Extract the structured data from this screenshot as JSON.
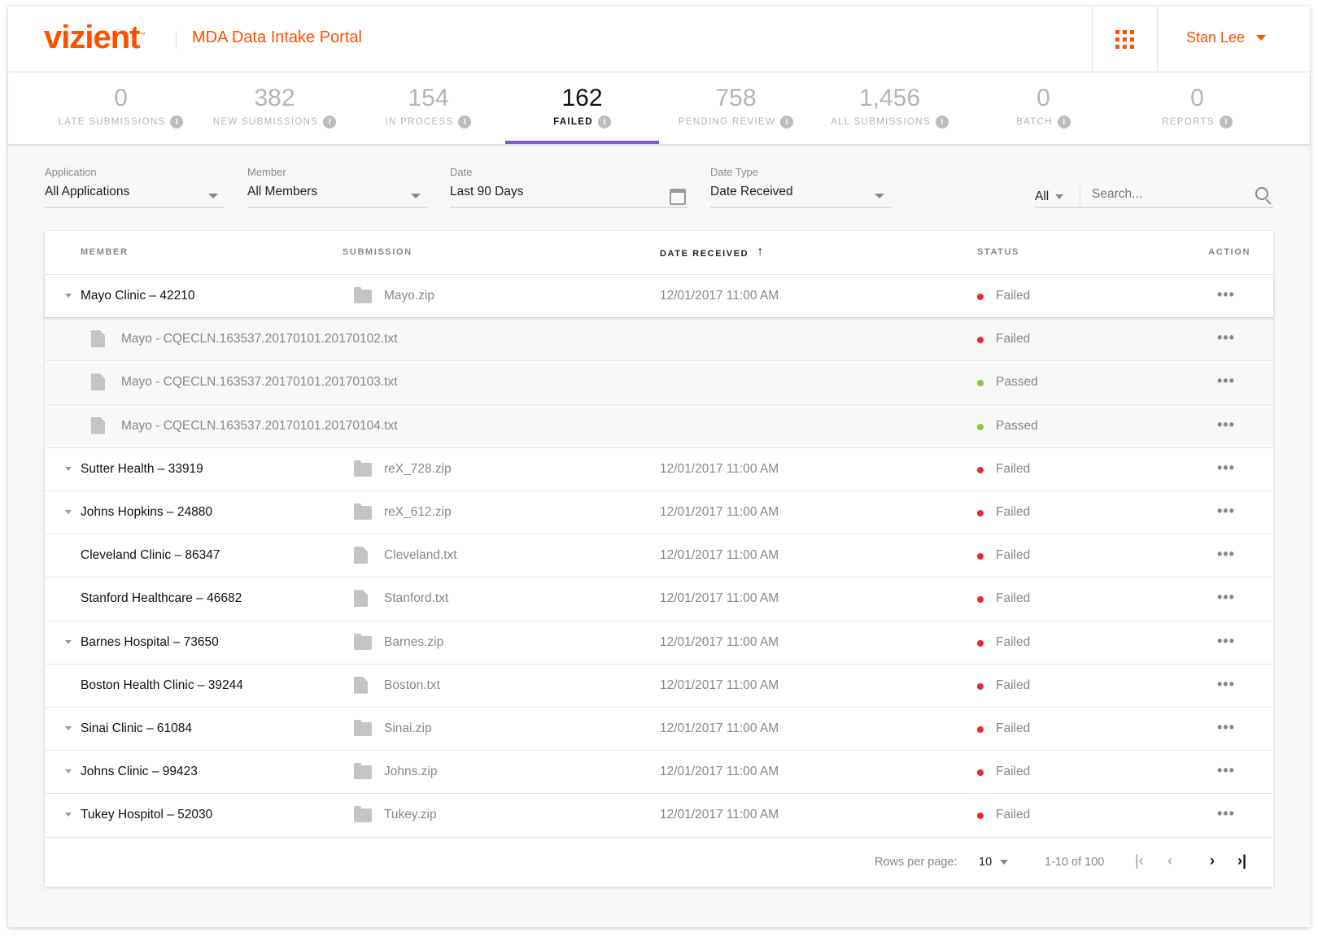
{
  "header": {
    "logo": "vizient",
    "app_title": "MDA Data Intake Portal",
    "user_name": "Stan Lee"
  },
  "tabs": [
    {
      "count": "0",
      "label": "LATE SUBMISSIONS",
      "active": false
    },
    {
      "count": "382",
      "label": "NEW SUBMISSIONS",
      "active": false
    },
    {
      "count": "154",
      "label": "IN PROCESS",
      "active": false
    },
    {
      "count": "162",
      "label": "FAILED",
      "active": true
    },
    {
      "count": "758",
      "label": "PENDING REVIEW",
      "active": false
    },
    {
      "count": "1,456",
      "label": "ALL SUBMISSIONS",
      "active": false
    },
    {
      "count": "0",
      "label": "BATCH",
      "active": false
    },
    {
      "count": "0",
      "label": "REPORTS",
      "active": false
    }
  ],
  "info_glyph": "i",
  "filters": {
    "application": {
      "label": "Application",
      "value": "All Applications"
    },
    "member": {
      "label": "Member",
      "value": "All Members"
    },
    "date": {
      "label": "Date",
      "value": "Last 90 Days"
    },
    "date_type": {
      "label": "Date Type",
      "value": "Date Received"
    },
    "scope": "All",
    "search_placeholder": "Search..."
  },
  "table": {
    "columns": {
      "member": "MEMBER",
      "submission": "SUBMISSION",
      "date": "DATE RECEIVED",
      "status": "STATUS",
      "action": "ACTION"
    },
    "sort_arrow": "↑",
    "rows": [
      {
        "kind": "parent",
        "expandable": true,
        "expanded": true,
        "member": "Mayo Clinic – 42210",
        "icon": "folder",
        "submission": "Mayo.zip",
        "date": "12/01/2017 11:00 AM",
        "status": "Failed"
      },
      {
        "kind": "child",
        "icon": "file",
        "submission": "Mayo - CQECLN.163537.20170101.20170102.txt",
        "date": "",
        "status": "Failed"
      },
      {
        "kind": "child",
        "icon": "file",
        "submission": "Mayo - CQECLN.163537.20170101.20170103.txt",
        "date": "",
        "status": "Passed"
      },
      {
        "kind": "child",
        "icon": "file",
        "submission": "Mayo - CQECLN.163537.20170101.20170104.txt",
        "date": "",
        "status": "Passed"
      },
      {
        "kind": "parent",
        "expandable": true,
        "member": "Sutter Health – 33919",
        "icon": "folder",
        "submission": "reX_728.zip",
        "date": "12/01/2017 11:00 AM",
        "status": "Failed"
      },
      {
        "kind": "parent",
        "expandable": true,
        "member": "Johns Hopkins – 24880",
        "icon": "folder",
        "submission": "reX_612.zip",
        "date": "12/01/2017 11:00 AM",
        "status": "Failed"
      },
      {
        "kind": "parent",
        "expandable": false,
        "member": "Cleveland Clinic – 86347",
        "icon": "file",
        "submission": "Cleveland.txt",
        "date": "12/01/2017 11:00 AM",
        "status": "Failed"
      },
      {
        "kind": "parent",
        "expandable": false,
        "member": "Stanford Healthcare – 46682",
        "icon": "file",
        "submission": "Stanford.txt",
        "date": "12/01/2017 11:00 AM",
        "status": "Failed"
      },
      {
        "kind": "parent",
        "expandable": true,
        "member": "Barnes Hospital – 73650",
        "icon": "folder",
        "submission": "Barnes.zip",
        "date": "12/01/2017 11:00 AM",
        "status": "Failed"
      },
      {
        "kind": "parent",
        "expandable": false,
        "member": "Boston Health Clinic – 39244",
        "icon": "file",
        "submission": "Boston.txt",
        "date": "12/01/2017 11:00 AM",
        "status": "Failed"
      },
      {
        "kind": "parent",
        "expandable": true,
        "member": "Sinai Clinic – 61084",
        "icon": "folder",
        "submission": "Sinai.zip",
        "date": "12/01/2017 11:00 AM",
        "status": "Failed"
      },
      {
        "kind": "parent",
        "expandable": true,
        "member": "Johns Clinic – 99423",
        "icon": "folder",
        "submission": "Johns.zip",
        "date": "12/01/2017 11:00 AM",
        "status": "Failed"
      },
      {
        "kind": "parent",
        "expandable": true,
        "member": "Tukey Hospitol – 52030",
        "icon": "folder",
        "submission": "Tukey.zip",
        "date": "12/01/2017 11:00 AM",
        "status": "Failed"
      }
    ],
    "action_glyph": "•••"
  },
  "pagination": {
    "rows_per_page_label": "Rows per page:",
    "rows_per_page": "10",
    "range": "1-10 of 100",
    "first": "|‹",
    "prev": "‹",
    "next": "›",
    "last": "›|"
  },
  "colors": {
    "brand": "#ff4f00",
    "active_tab": "#7a5cc4",
    "failed": "#f0262b",
    "passed": "#8dc63f"
  }
}
